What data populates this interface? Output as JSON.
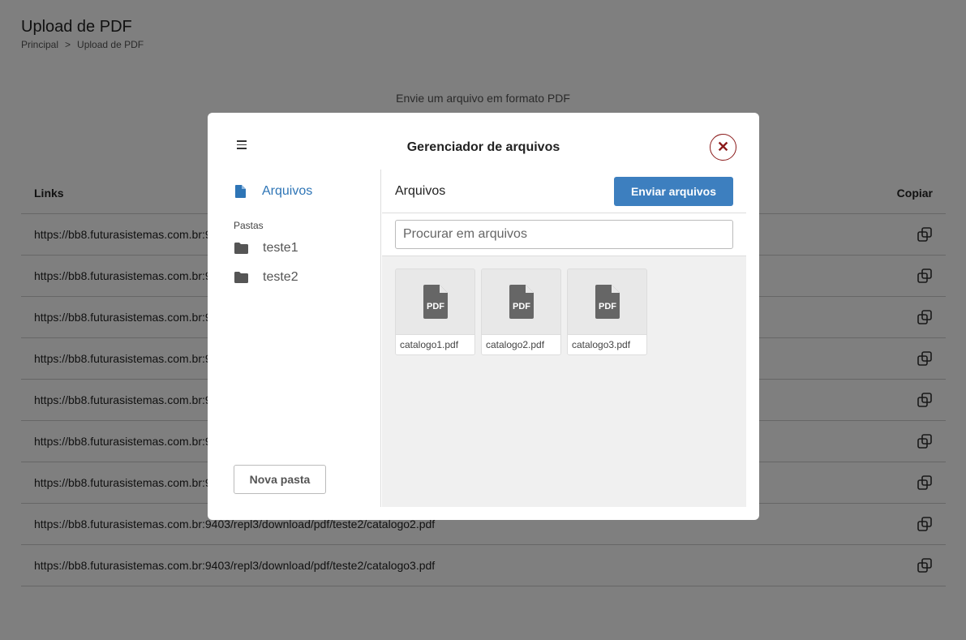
{
  "page": {
    "title": "Upload de PDF",
    "breadcrumb": [
      "Principal",
      "Upload de PDF"
    ],
    "upload_hint": "Envie um arquivo em formato PDF"
  },
  "links_table": {
    "col_links": "Links",
    "col_copy": "Copiar",
    "rows": [
      "https://bb8.futurasistemas.com.br:9",
      "https://bb8.futurasistemas.com.br:9",
      "https://bb8.futurasistemas.com.br:9",
      "https://bb8.futurasistemas.com.br:9",
      "https://bb8.futurasistemas.com.br:9",
      "https://bb8.futurasistemas.com.br:9",
      "https://bb8.futurasistemas.com.br:9",
      "https://bb8.futurasistemas.com.br:9403/repl3/download/pdf/teste2/catalogo2.pdf",
      "https://bb8.futurasistemas.com.br:9403/repl3/download/pdf/teste2/catalogo3.pdf"
    ]
  },
  "modal": {
    "title": "Gerenciador de arquivos",
    "close_symbol": "✕",
    "sidebar": {
      "files_label": "Arquivos",
      "folders_label": "Pastas",
      "folders": [
        "teste1",
        "teste2"
      ],
      "new_folder": "Nova pasta"
    },
    "main": {
      "title": "Arquivos",
      "send_button": "Enviar arquivos",
      "search_placeholder": "Procurar em arquivos",
      "files": [
        {
          "name": "catalogo1.pdf",
          "icon": "pdf-file-icon"
        },
        {
          "name": "catalogo2.pdf",
          "icon": "pdf-file-icon"
        },
        {
          "name": "catalogo3.pdf",
          "icon": "pdf-file-icon"
        }
      ]
    }
  },
  "colors": {
    "accent": "#3d7fbf",
    "link_active": "#2e75b6",
    "close": "#8b1a1a"
  }
}
